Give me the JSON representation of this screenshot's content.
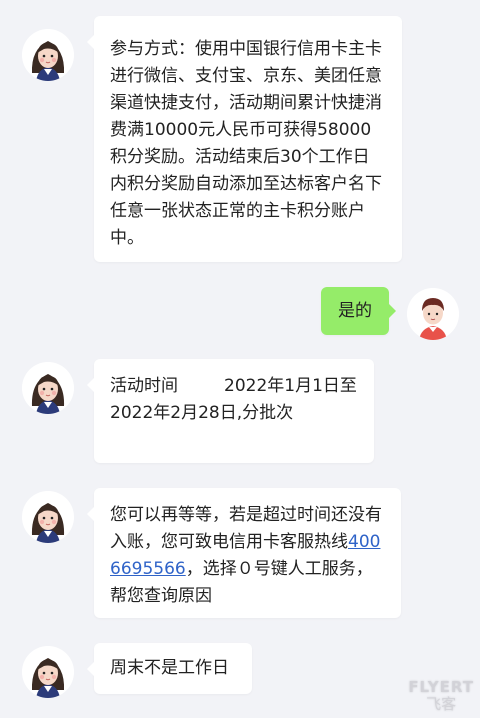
{
  "messages": [
    {
      "sender": "agent",
      "text": "参与方式：使用中国银行信用卡主卡进行微信、支付宝、京东、美团任意渠道快捷支付，活动期间累计快捷消费满10000元人民币可获得58000积分奖励。活动结束后30个工作日内积分奖励自动添加至达标客户名下任意一张状态正常的主卡积分账户中。"
    },
    {
      "sender": "user",
      "text": "是的"
    },
    {
      "sender": "agent",
      "text_part1": "活动时间",
      "text_part2": "2022年1月1日至2022年2月28日,分批次"
    },
    {
      "sender": "agent",
      "text_before": "您可以再等等，若是超过时间还没有入账，您可致电信用卡客服热线",
      "phone": "4006695566",
      "text_after": "，选择０号键人工服务，帮您查询原因"
    },
    {
      "sender": "agent",
      "text": "周末不是工作日"
    }
  ],
  "watermark": {
    "brand": "FLYERT",
    "subtitle": "飞客"
  },
  "colors": {
    "background": "#f2f3f7",
    "agent_bubble": "#ffffff",
    "user_bubble": "#95ec69",
    "link": "#2f63c8"
  },
  "icons": {
    "agent_avatar": "female-agent-avatar-icon",
    "user_avatar": "male-user-avatar-icon"
  }
}
